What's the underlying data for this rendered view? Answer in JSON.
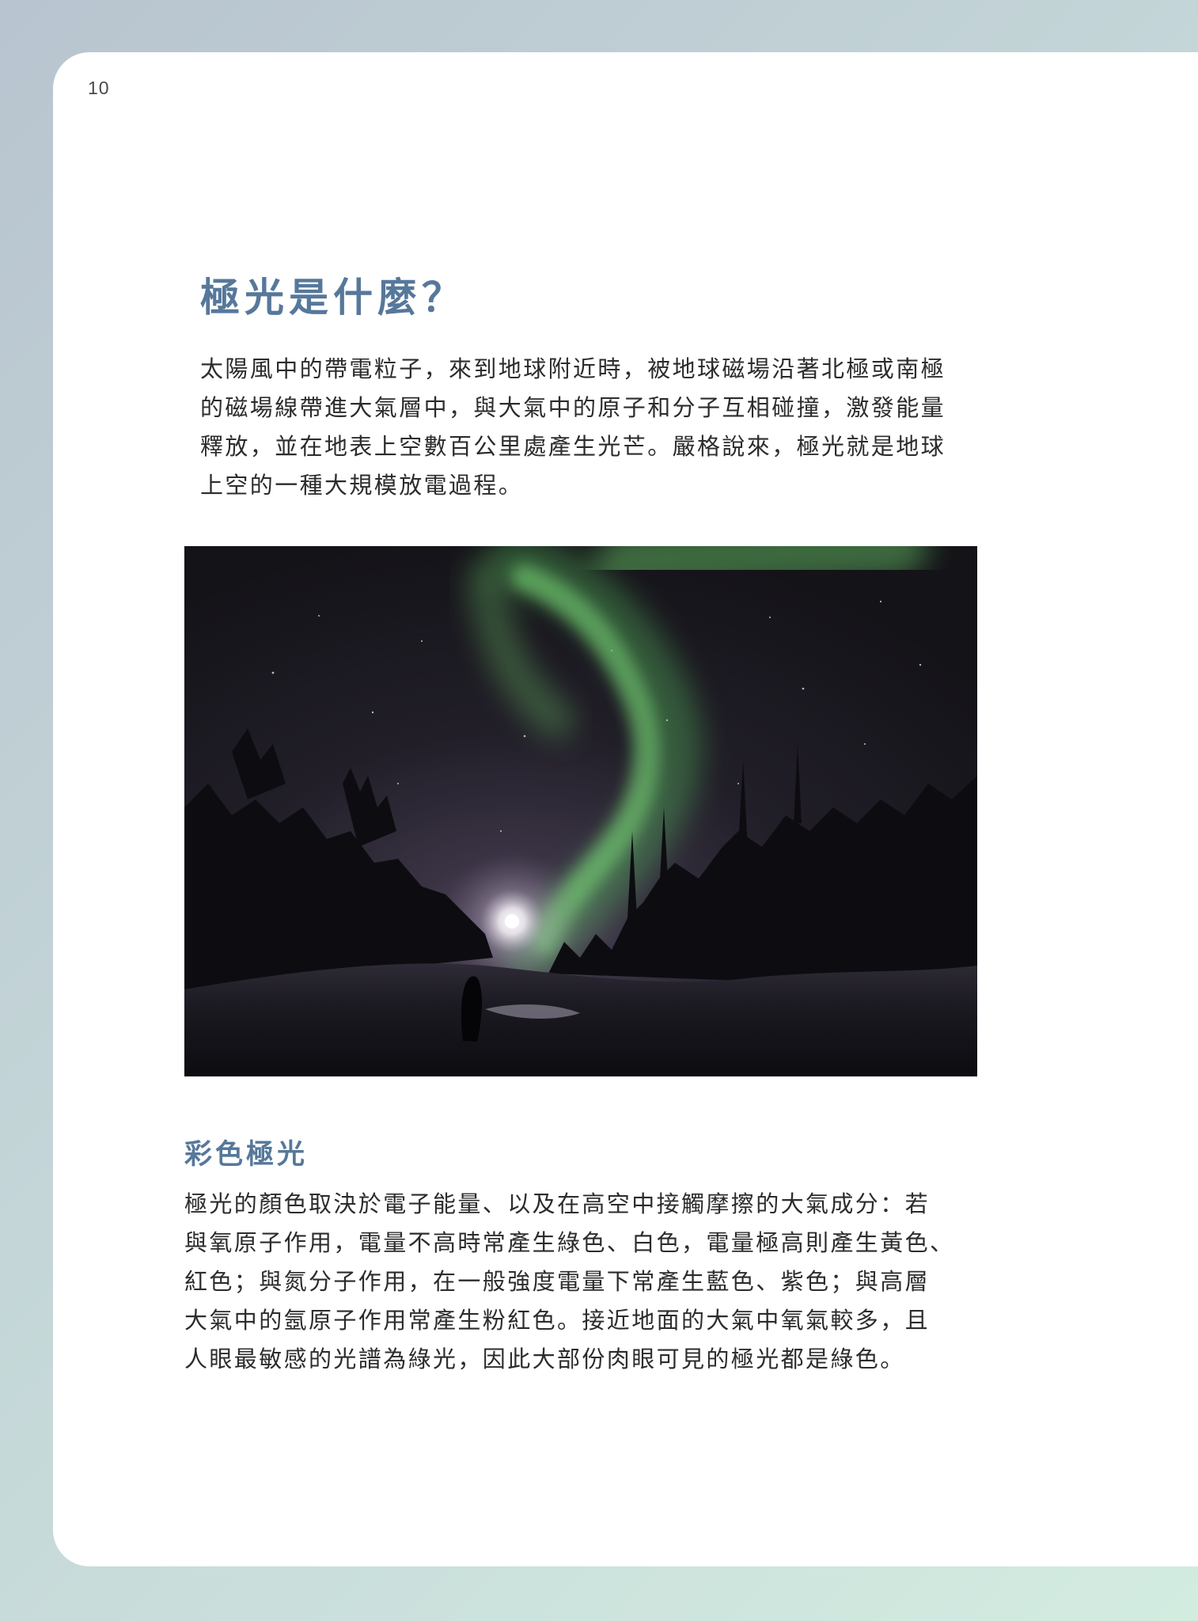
{
  "page": {
    "number": "10"
  },
  "section": {
    "title": "極光是什麼？",
    "intro": "太陽風中的帶電粒子，來到地球附近時，被地球磁場沿著北極或南極\n的磁場線帶進大氣層中，與大氣中的原子和分子互相碰撞，激發能量\n釋放，並在地表上空數百公里處產生光芒。嚴格說來，極光就是地球\n上空的一種大規模放電過程。"
  },
  "photo": {
    "subject": "green aurora over snowy forest at night with bright moon near horizon",
    "colors": {
      "sky": "#1c1a22",
      "aurora": "#6fc86a",
      "ground": "#0c0c10",
      "moon": "#ffffff"
    }
  },
  "subsection": {
    "title": "彩色極光",
    "body": "極光的顏色取決於電子能量、以及在高空中接觸摩擦的大氣成分：若\n與氧原子作用，電量不高時常產生綠色、白色，電量極高則產生黃色、\n紅色；與氮分子作用，在一般強度電量下常產生藍色、紫色；與高層\n大氣中的氬原子作用常產生粉紅色。接近地面的大氣中氧氣較多，且\n人眼最敏感的光譜為綠光，因此大部份肉眼可見的極光都是綠色。"
  },
  "theme": {
    "heading_color": "#56789a",
    "text_color": "#2c2c2c"
  }
}
